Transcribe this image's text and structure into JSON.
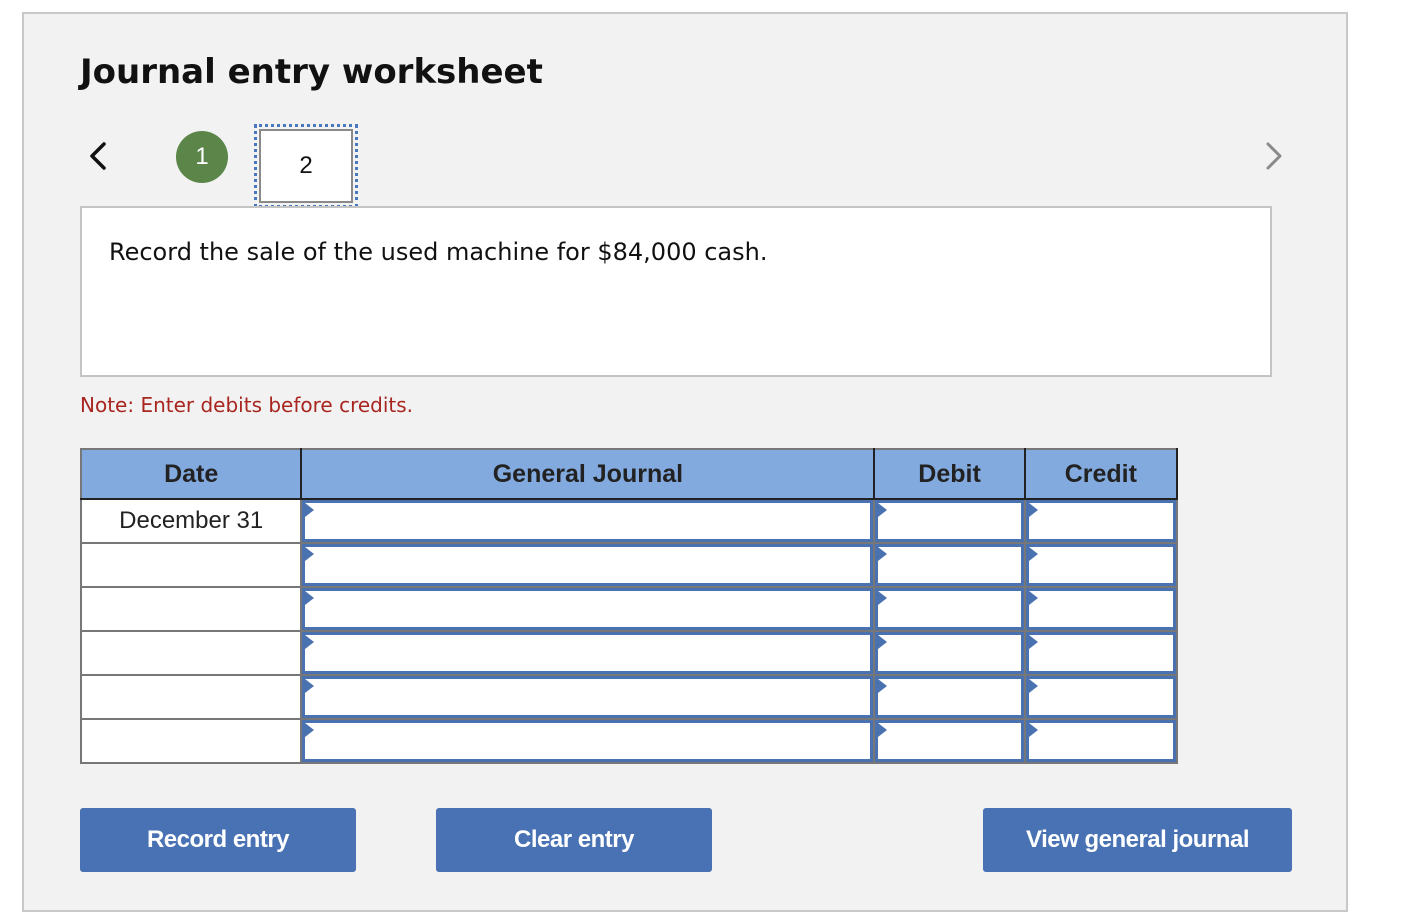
{
  "worksheet": {
    "title": "Journal entry worksheet",
    "steps": [
      {
        "label": "1",
        "status": "completed"
      },
      {
        "label": "2",
        "status": "current"
      }
    ],
    "prompt": "Record the sale of the used machine for $84,000 cash.",
    "note": "Note: Enter debits before credits."
  },
  "table": {
    "headers": {
      "date": "Date",
      "journal": "General Journal",
      "debit": "Debit",
      "credit": "Credit"
    },
    "rows": [
      {
        "date": "December 31",
        "account": "",
        "debit": "",
        "credit": ""
      },
      {
        "date": "",
        "account": "",
        "debit": "",
        "credit": ""
      },
      {
        "date": "",
        "account": "",
        "debit": "",
        "credit": ""
      },
      {
        "date": "",
        "account": "",
        "debit": "",
        "credit": ""
      },
      {
        "date": "",
        "account": "",
        "debit": "",
        "credit": ""
      },
      {
        "date": "",
        "account": "",
        "debit": "",
        "credit": ""
      }
    ]
  },
  "buttons": {
    "record": "Record entry",
    "clear": "Clear entry",
    "view": "View general journal"
  },
  "colors": {
    "accent": "#4872b4",
    "header_bg": "#82aadf",
    "step_done": "#5b8549",
    "note": "#a8261f"
  }
}
